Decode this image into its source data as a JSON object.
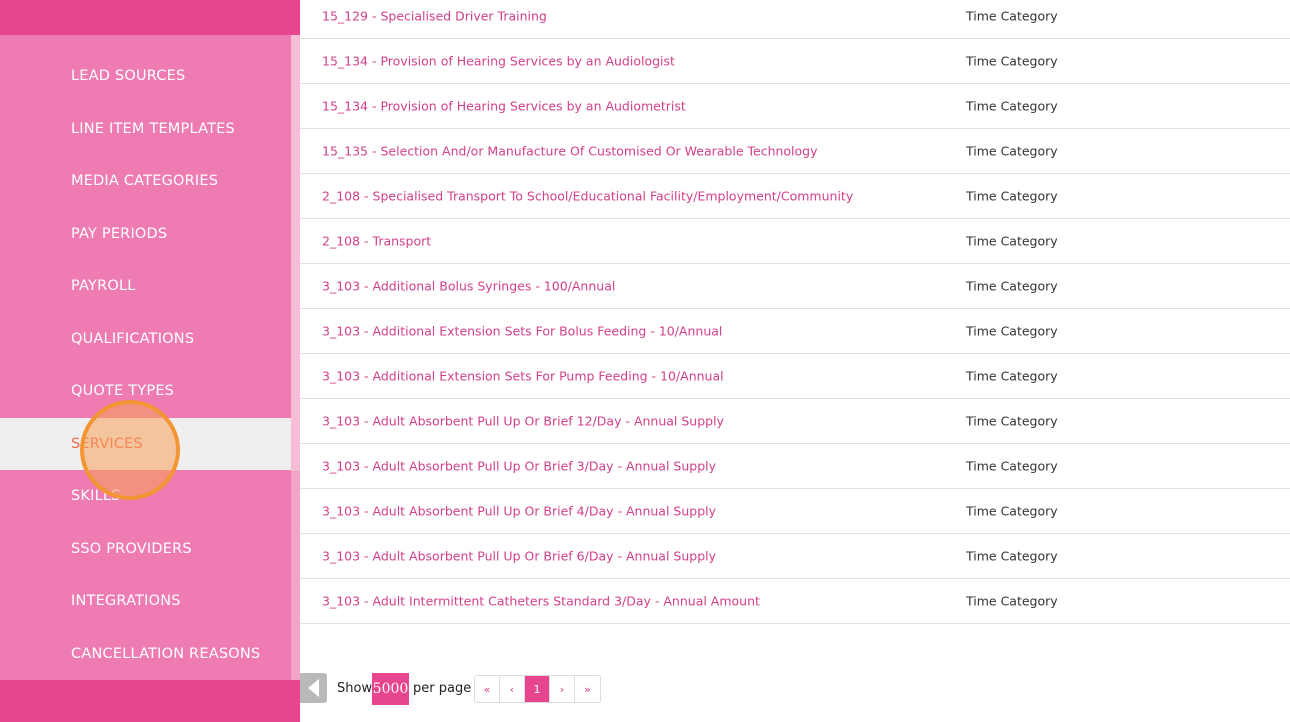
{
  "sidebar": {
    "items": [
      {
        "label": "LEAD SOURCES"
      },
      {
        "label": "LINE ITEM TEMPLATES"
      },
      {
        "label": "MEDIA CATEGORIES"
      },
      {
        "label": "PAY PERIODS"
      },
      {
        "label": "PAYROLL"
      },
      {
        "label": "QUALIFICATIONS"
      },
      {
        "label": "QUOTE TYPES"
      },
      {
        "label": "SERVICES",
        "active": true
      },
      {
        "label": "SKILLS"
      },
      {
        "label": "SSO PROVIDERS"
      },
      {
        "label": "INTEGRATIONS"
      },
      {
        "label": "CANCELLATION REASONS"
      }
    ]
  },
  "table": {
    "rows": [
      {
        "name": "15_129 - Specialised Driver Training",
        "category": "Time Category"
      },
      {
        "name": "15_134 - Provision of Hearing Services by an Audiologist",
        "category": "Time Category"
      },
      {
        "name": "15_134 - Provision of Hearing Services by an Audiometrist",
        "category": "Time Category"
      },
      {
        "name": "15_135 - Selection And/or Manufacture Of Customised Or Wearable Technology",
        "category": "Time Category"
      },
      {
        "name": "2_108 - Specialised Transport To School/Educational Facility/Employment/Community",
        "category": "Time Category"
      },
      {
        "name": "2_108 - Transport",
        "category": "Time Category"
      },
      {
        "name": "3_103 - Additional Bolus Syringes - 100/Annual",
        "category": "Time Category"
      },
      {
        "name": "3_103 - Additional Extension Sets For Bolus Feeding - 10/Annual",
        "category": "Time Category"
      },
      {
        "name": "3_103 - Additional Extension Sets For Pump Feeding - 10/Annual",
        "category": "Time Category"
      },
      {
        "name": "3_103 - Adult Absorbent Pull Up Or Brief 12/Day - Annual Supply",
        "category": "Time Category"
      },
      {
        "name": "3_103 - Adult Absorbent Pull Up Or Brief 3/Day - Annual Supply",
        "category": "Time Category"
      },
      {
        "name": "3_103 - Adult Absorbent Pull Up Or Brief 4/Day - Annual Supply",
        "category": "Time Category"
      },
      {
        "name": "3_103 - Adult Absorbent Pull Up Or Brief 6/Day - Annual Supply",
        "category": "Time Category"
      },
      {
        "name": "3_103 - Adult Intermittent Catheters Standard 3/Day - Annual Amount",
        "category": "Time Category"
      }
    ]
  },
  "pagination": {
    "show_label": "Show",
    "per_page_value": "5000",
    "per_page_label": "per page",
    "first": "«",
    "prev": "‹",
    "current_page": "1",
    "next": "›",
    "last": "»"
  },
  "icons": {
    "collapse": "collapse-sidebar-icon"
  },
  "colors": {
    "brand": "#e8458f",
    "sidebar": "#ee7cb2",
    "link": "#d1408a",
    "active_text": "#f06a4a",
    "click_indicator": "#f39533"
  }
}
